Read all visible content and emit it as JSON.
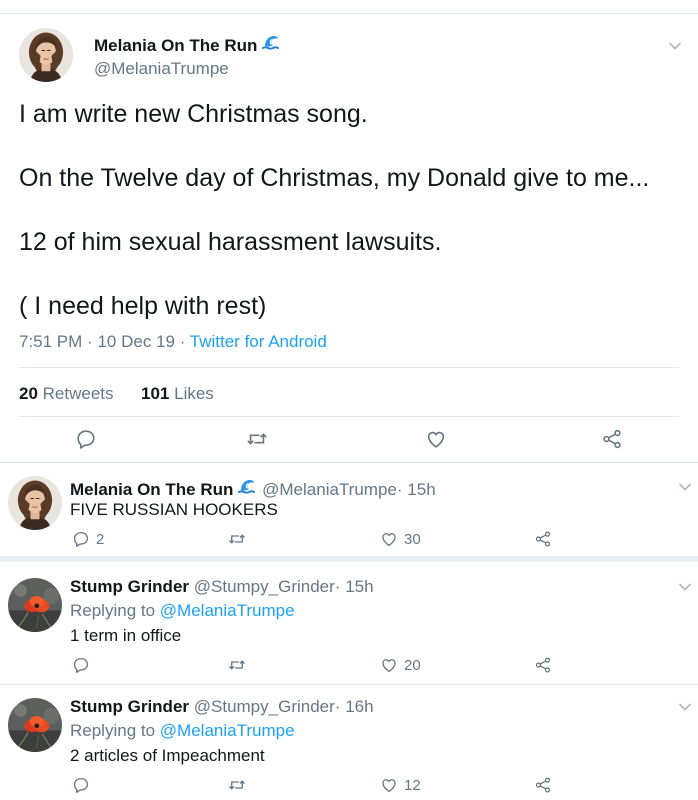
{
  "main_tweet": {
    "author_name": "Melania On The Run",
    "author_handle": "@MelaniaTrumpe",
    "lines": [
      "I am write new Christmas song.",
      "On the Twelve day of Christmas, my Donald give to me...",
      "12 of him sexual harassment lawsuits.",
      "( I need help with rest)"
    ],
    "time": "7:51 PM",
    "date": "10 Dec 19",
    "source": "Twitter for Android",
    "retweets_count": "20",
    "retweets_label": "Retweets",
    "likes_count": "101",
    "likes_label": "Likes"
  },
  "replies": [
    {
      "author_name": "Melania On The Run",
      "author_handle": "@MelaniaTrumpe",
      "age": "15h",
      "replying_to_label": "",
      "replying_to_handle": "",
      "text": "FIVE RUSSIAN HOOKERS",
      "reply_count": "2",
      "like_count": "30"
    },
    {
      "author_name": "Stump Grinder",
      "author_handle": "@Stumpy_Grinder",
      "age": "15h",
      "replying_to_label": "Replying to",
      "replying_to_handle": "@MelaniaTrumpe",
      "text": "1 term in office",
      "reply_count": "",
      "like_count": "20"
    },
    {
      "author_name": "Stump Grinder",
      "author_handle": "@Stumpy_Grinder",
      "age": "16h",
      "replying_to_label": "Replying to",
      "replying_to_handle": "@MelaniaTrumpe",
      "text": "2 articles of Impeachment",
      "reply_count": "",
      "like_count": "12"
    }
  ],
  "separator_dot": "·",
  "colors": {
    "link": "#1da1f2",
    "secondary": "#657786",
    "divider": "#e1e8ed"
  },
  "icons": [
    "reply-icon",
    "retweet-icon",
    "like-icon",
    "share-icon",
    "chevron-down-icon",
    "wave-emoji-icon"
  ]
}
